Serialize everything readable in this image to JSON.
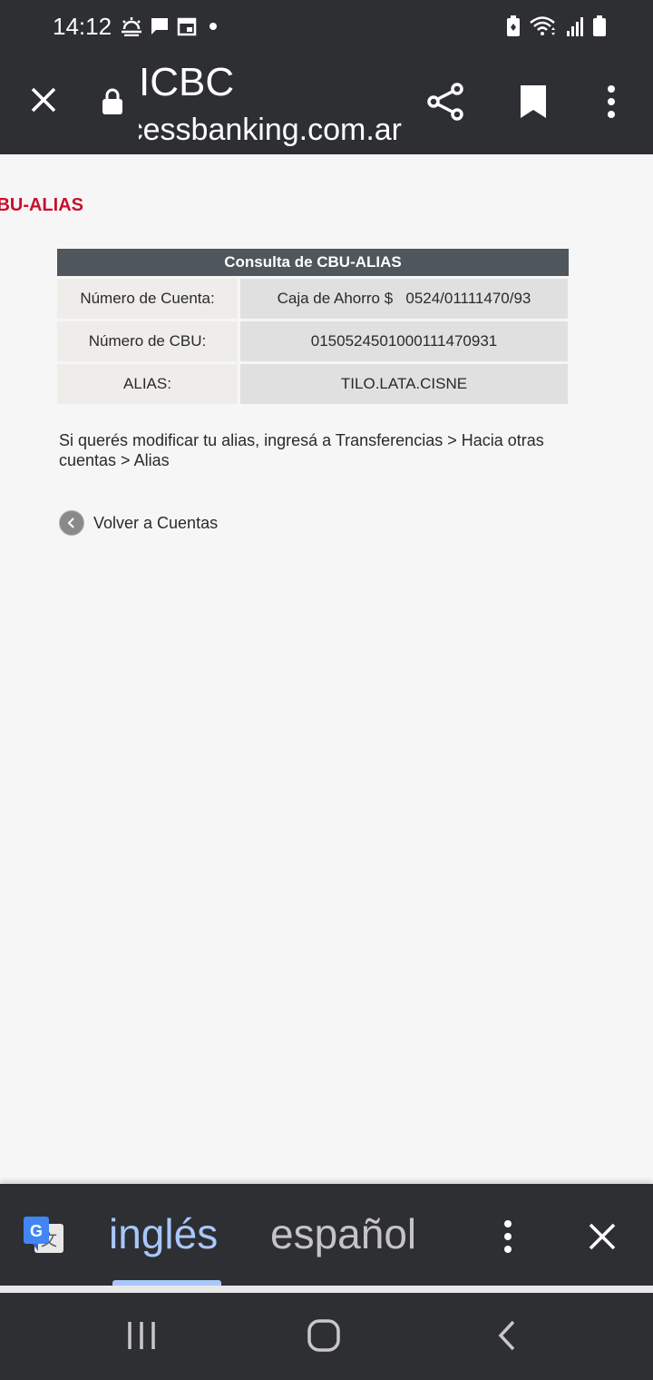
{
  "status_bar": {
    "time": "14:12",
    "icons_left": [
      "weather-icon",
      "chat-icon",
      "calendar-icon",
      "dot-icon"
    ],
    "icons_right": [
      "battery-saver-icon",
      "wifi-icon",
      "signal-icon",
      "battery-icon"
    ]
  },
  "browser": {
    "title": "ICBC",
    "url": "accessbanking.com.ar",
    "actions": [
      "close-icon",
      "lock-icon",
      "share-icon",
      "bookmark-icon",
      "more-icon"
    ]
  },
  "page": {
    "heading": "CBU-ALIAS",
    "table": {
      "title": "Consulta de CBU-ALIAS",
      "rows": [
        {
          "label": "Número de Cuenta:",
          "value": "Caja de Ahorro $   0524/01111470/93"
        },
        {
          "label": "Número de CBU:",
          "value": "0150524501000111470931"
        },
        {
          "label": "ALIAS:",
          "value": "TILO.LATA.CISNE"
        }
      ]
    },
    "info_text": "Si querés modificar tu alias, ingresá a Transferencias > Hacia otras cuentas > Alias",
    "back_link": "Volver a Cuentas"
  },
  "translate_bar": {
    "active_language": "inglés",
    "other_language": "español"
  },
  "colors": {
    "dark_bar": "#2e2f33",
    "heading_red": "#c8102e",
    "table_header": "#4f565c",
    "translate_accent": "#a8c7fa"
  }
}
